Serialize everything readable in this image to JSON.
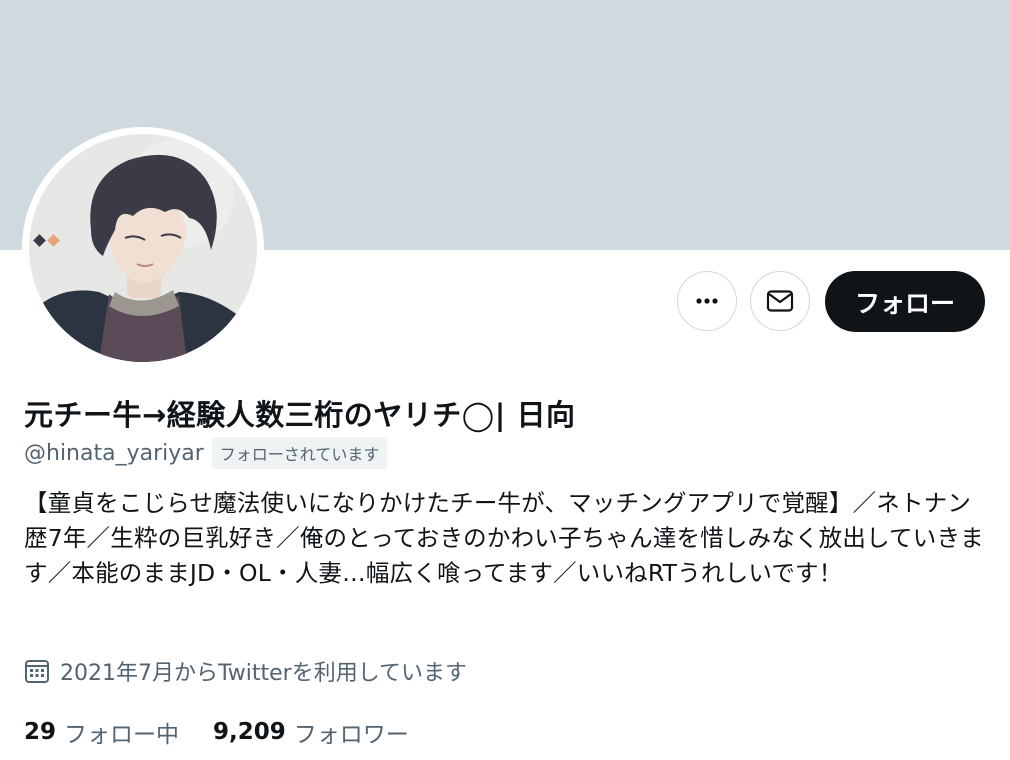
{
  "profile": {
    "display_name": "元チー牛→経験人数三桁のヤリチ◯| 日向",
    "handle": "@hinata_yariyar",
    "follows_you_label": "フォローされています",
    "bio": "【童貞をこじらせ魔法使いになりかけたチー牛が、マッチングアプリで覚醒】／ネトナン歴7年／生粋の巨乳好き／俺のとっておきのかわい子ちゃん達を惜しみなく放出していきます／本能のままJD・OL・人妻…幅広く喰ってます／いいねRTうれしいです！",
    "joined": "2021年7月からTwitterを利用しています",
    "following_count": "29",
    "following_label": "フォロー中",
    "followers_count": "9,209",
    "followers_label": "フォロワー"
  },
  "actions": {
    "more_icon": "more-horizontal-icon",
    "message_icon": "envelope-icon",
    "follow_label": "フォロー"
  },
  "colors": {
    "banner": "#cfd9de",
    "primary_text": "#0f1419",
    "secondary_text": "#536471",
    "follow_button_bg": "#0f1419",
    "border": "#cfd9de"
  }
}
